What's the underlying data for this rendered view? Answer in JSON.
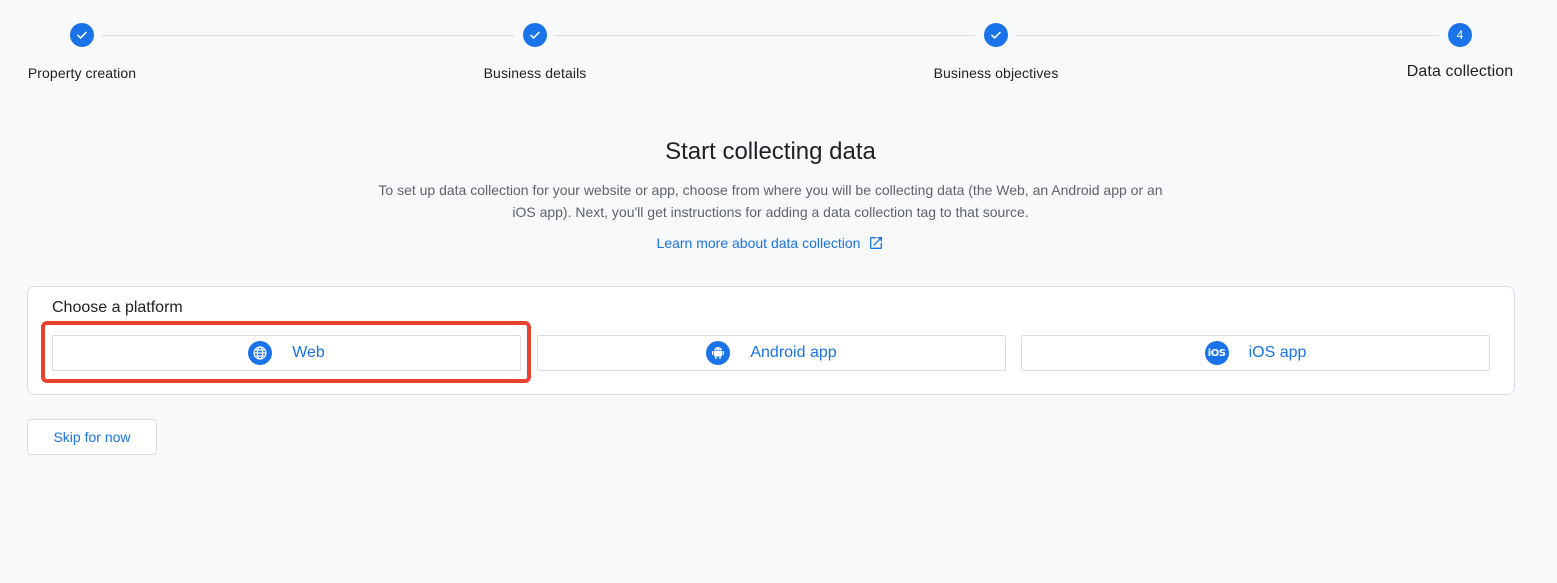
{
  "stepper": {
    "steps": [
      {
        "label": "Property creation",
        "state": "done"
      },
      {
        "label": "Business details",
        "state": "done"
      },
      {
        "label": "Business objectives",
        "state": "done"
      },
      {
        "label": "Data collection",
        "number": "4",
        "state": "current"
      }
    ]
  },
  "main": {
    "title": "Start collecting data",
    "description": "To set up data collection for your website or app, choose from where you will be collecting data (the Web, an Android app or an iOS app). Next, you'll get instructions for adding a data collection tag to that source.",
    "learn_more_label": "Learn more about data collection"
  },
  "platforms": {
    "heading": "Choose a platform",
    "options": [
      {
        "label": "Web",
        "icon": "globe-icon"
      },
      {
        "label": "Android app",
        "icon": "android-icon"
      },
      {
        "label": "iOS app",
        "icon": "ios-icon",
        "icon_text": "iOS"
      }
    ]
  },
  "actions": {
    "skip_label": "Skip for now"
  },
  "colors": {
    "accent": "#1a73e8",
    "highlight": "#e8412e",
    "background": "#f8f9fa"
  }
}
